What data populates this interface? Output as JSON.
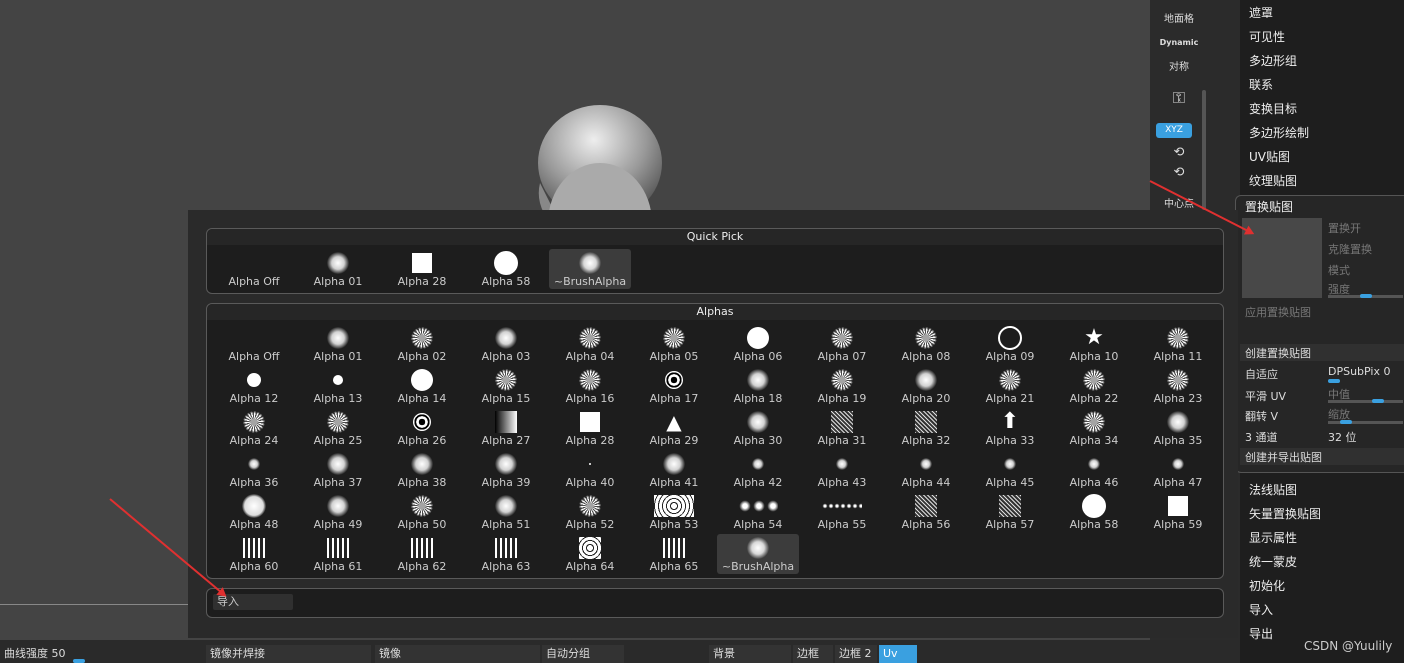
{
  "shelf": {
    "sym_label": "地面格",
    "dynamic_label": "Dynamic",
    "sym2_label": "对称",
    "xyz_label": "XYZ",
    "center_label": "中心点"
  },
  "right_menu": {
    "items": [
      "遮罩",
      "可见性",
      "多边形组",
      "联系",
      "变换目标",
      "多边形绘制",
      "UV贴图",
      "纹理贴图"
    ],
    "bottom_items": [
      "法线贴图",
      "矢量置换贴图",
      "显示属性",
      "统一蒙皮",
      "初始化",
      "导入",
      "导出"
    ]
  },
  "displacement": {
    "title": "置换贴图",
    "on_label": "置换开",
    "clone_label": "克隆置换",
    "mode_label": "模式",
    "intensity_label": "强度",
    "apply_label": "应用置换贴图",
    "create_label": "创建置换贴图",
    "adaptive_label": "自适应",
    "dpsubpix_label": "DPSubPix 0",
    "smooth_uv_label": "平滑 UV",
    "mid_label": "中值",
    "flip_v_label": "翻转 V",
    "scale_label": "缩放",
    "channel_label": "3 通道",
    "bits_label": "32 位",
    "create_export_label": "创建并导出贴图"
  },
  "quick_pick": {
    "title": "Quick Pick",
    "items": [
      "Alpha Off",
      "Alpha 01",
      "Alpha 28",
      "Alpha 58",
      "~BrushAlpha"
    ]
  },
  "alphas": {
    "title": "Alphas",
    "items": [
      "Alpha Off",
      "Alpha 01",
      "Alpha 02",
      "Alpha 03",
      "Alpha 04",
      "Alpha 05",
      "Alpha 06",
      "Alpha 07",
      "Alpha 08",
      "Alpha 09",
      "Alpha 10",
      "Alpha 11",
      "Alpha 12",
      "Alpha 13",
      "Alpha 14",
      "Alpha 15",
      "Alpha 16",
      "Alpha 17",
      "Alpha 18",
      "Alpha 19",
      "Alpha 20",
      "Alpha 21",
      "Alpha 22",
      "Alpha 23",
      "Alpha 24",
      "Alpha 25",
      "Alpha 26",
      "Alpha 27",
      "Alpha 28",
      "Alpha 29",
      "Alpha 30",
      "Alpha 31",
      "Alpha 32",
      "Alpha 33",
      "Alpha 34",
      "Alpha 35",
      "Alpha 36",
      "Alpha 37",
      "Alpha 38",
      "Alpha 39",
      "Alpha 40",
      "Alpha 41",
      "Alpha 42",
      "Alpha 43",
      "Alpha 44",
      "Alpha 45",
      "Alpha 46",
      "Alpha 47",
      "Alpha 48",
      "Alpha 49",
      "Alpha 50",
      "Alpha 51",
      "Alpha 52",
      "Alpha 53",
      "Alpha 54",
      "Alpha 55",
      "Alpha 56",
      "Alpha 57",
      "Alpha 58",
      "Alpha 59",
      "Alpha 60",
      "Alpha 61",
      "Alpha 62",
      "Alpha 63",
      "Alpha 64",
      "Alpha 65",
      "~BrushAlpha"
    ]
  },
  "import_label": "导入",
  "bottom_bar": {
    "curve_label": "曲线强度 50",
    "mirror_weld_label": "镜像并焊接",
    "mirror_label": "镜像",
    "auto_group_label": "自动分组",
    "background_label": "背景",
    "border_label": "边框",
    "border2_label": "边框 2",
    "uv_label": "Uv"
  },
  "watermark": "CSDN @Yuulily",
  "colors": {
    "accent": "#3aa0e0",
    "arrow": "#e03030"
  }
}
